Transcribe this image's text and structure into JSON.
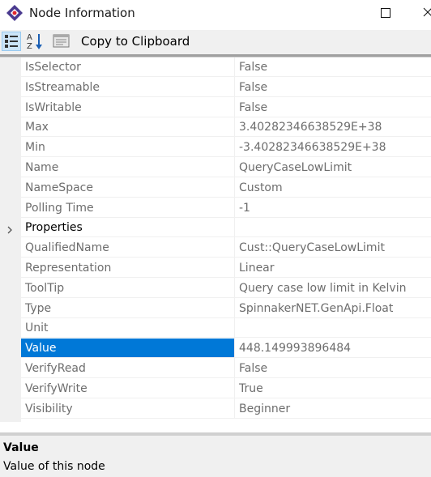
{
  "window": {
    "title": "Node Information",
    "icon": "app-diamond-icon"
  },
  "toolbar": {
    "categorized_icon": "categorized-view-icon",
    "alphabetical_icon": "alphabetical-sort-icon",
    "pages_icon": "property-pages-icon",
    "copy_label": "Copy to Clipboard"
  },
  "properties": [
    {
      "name": "IsSelector",
      "value": "False"
    },
    {
      "name": "IsStreamable",
      "value": "False"
    },
    {
      "name": "IsWritable",
      "value": "False"
    },
    {
      "name": "Max",
      "value": "3.40282346638529E+38"
    },
    {
      "name": "Min",
      "value": "-3.40282346638529E+38"
    },
    {
      "name": "Name",
      "value": "QueryCaseLowLimit"
    },
    {
      "name": "NameSpace",
      "value": "Custom"
    },
    {
      "name": "Polling Time",
      "value": "-1"
    },
    {
      "name": "Properties",
      "value": "",
      "expandable": true
    },
    {
      "name": "QualifiedName",
      "value": "Cust::QueryCaseLowLimit"
    },
    {
      "name": "Representation",
      "value": "Linear"
    },
    {
      "name": "ToolTip",
      "value": "Query case low limit in Kelvin"
    },
    {
      "name": "Type",
      "value": "SpinnakerNET.GenApi.Float"
    },
    {
      "name": "Unit",
      "value": ""
    },
    {
      "name": "Value",
      "value": "448.149993896484",
      "selected": true
    },
    {
      "name": "VerifyRead",
      "value": "False"
    },
    {
      "name": "VerifyWrite",
      "value": "True"
    },
    {
      "name": "Visibility",
      "value": "Beginner"
    }
  ],
  "description": {
    "title": "Value",
    "text": "Value of this node"
  },
  "colors": {
    "selection": "#0078d7",
    "toolbar_bg": "#f0f0f0",
    "grid_line": "#f0f0f0",
    "icon_accent": "#4a3a8f"
  }
}
